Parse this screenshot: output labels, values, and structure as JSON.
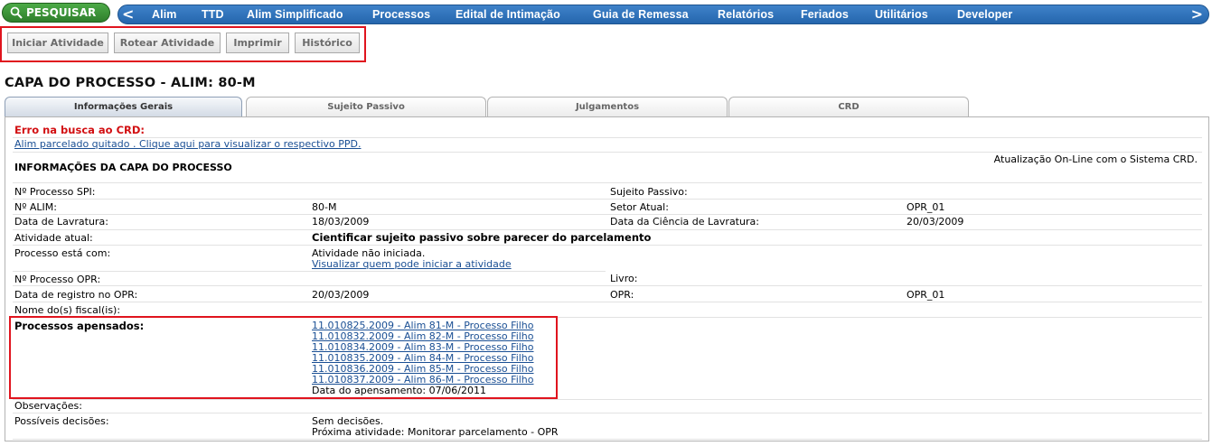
{
  "nav": {
    "search_label": "PESQUISAR",
    "prev_arrow": "<",
    "next_arrow": ">",
    "items": [
      "Alim",
      "TTD",
      "Alim Simplificado",
      "Processos",
      "Edital de Intimação",
      "Guia de Remessa",
      "Relatórios",
      "Feriados",
      "Utilitários",
      "Developer"
    ]
  },
  "toolbar": {
    "buttons": [
      "Iniciar Atividade",
      "Rotear Atividade",
      "Imprimir",
      "Histórico"
    ]
  },
  "page_title": "CAPA DO PROCESSO - ALIM: 80-M",
  "tabs": [
    "Informações Gerais",
    "Sujeito Passivo",
    "Julgamentos",
    "CRD"
  ],
  "info": {
    "error": "Erro na busca ao CRD:",
    "alim_link": "Alim parcelado quitado . Clique aqui para visualizar o respectivo PPD.",
    "section_title": "INFORMAÇÕES DA CAPA DO PROCESSO",
    "online_note": "Atualização On-Line com o Sistema CRD.",
    "labels": {
      "processo_spi": "Nº Processo SPI:",
      "sujeito_passivo": "Sujeito Passivo:",
      "alim": "Nº ALIM:",
      "setor_atual": "Setor Atual:",
      "data_lavratura": "Data de Lavratura:",
      "data_ciencia": "Data da Ciência de Lavratura:",
      "atividade_atual": "Atividade atual:",
      "processo_com": "Processo está com:",
      "processo_opr": "Nº Processo OPR:",
      "livro": "Livro:",
      "data_registro_opr": "Data de registro no OPR:",
      "opr": "OPR:",
      "fiscais": "Nome do(s) fiscal(is):",
      "apensados": "Processos apensados:",
      "observacoes": "Observações:",
      "decisoes": "Possíveis decisões:"
    },
    "values": {
      "alim": "80-M",
      "setor_atual": "OPR_01",
      "data_lavratura": "18/03/2009",
      "data_ciencia": "20/03/2009",
      "atividade_atual": "Cientificar sujeito passivo sobre parecer do parcelamento",
      "processo_com": "Atividade não iniciada.",
      "processo_com_link": "Visualizar quem pode iniciar a atividade",
      "data_registro_opr": "20/03/2009",
      "opr": "OPR_01",
      "apensados": [
        "11.010825.2009 - Alim 81-M - Processo Filho",
        "11.010832.2009 - Alim 82-M - Processo Filho",
        "11.010834.2009 - Alim 83-M - Processo Filho",
        "11.010835.2009 - Alim 84-M - Processo Filho",
        "11.010836.2009 - Alim 85-M - Processo Filho",
        "11.010837.2009 - Alim 86-M - Processo Filho"
      ],
      "data_apensamento": "Data do apensamento: 07/06/2011",
      "decisoes": "Sem decisões.",
      "proxima_atividade": "Próxima atividade: Monitorar parcelamento - OPR"
    }
  }
}
